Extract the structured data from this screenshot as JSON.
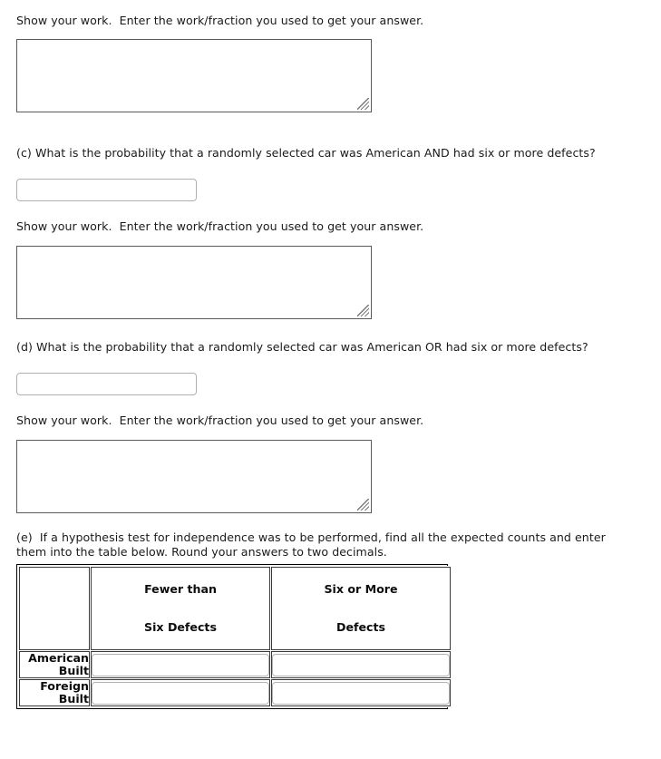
{
  "page": {
    "background": "#ffffff",
    "text_color": "#1a1a1a"
  },
  "sections": {
    "work_prompt_a": {
      "label": "Show your work.  Enter the work/fraction you used to get your answer.",
      "textarea_value": "",
      "textarea_placeholder": ""
    },
    "question_c": {
      "label": "(c) What is the probability that a randomly selected car was American AND had six or more defects?",
      "answer_value": "",
      "answer_placeholder": "",
      "work_label": "Show your work.  Enter the work/fraction you used to get your answer.",
      "work_value": ""
    },
    "question_d": {
      "label": "(d) What is the probability that a randomly selected car was American OR had six or more defects?",
      "answer_value": "",
      "answer_placeholder": "",
      "work_label": "Show your work.  Enter the work/fraction you used to get your answer.",
      "work_value": ""
    },
    "question_e": {
      "label_line1": "(e)  If a hypothesis test for independence was to be performed, find all the expected counts and enter",
      "label_line2": "them into the table below. Round your answers to two decimals."
    }
  },
  "expected_counts_table": {
    "corner_label": "",
    "column_headers": [
      {
        "line1": "Fewer than",
        "line2": "Six Defects"
      },
      {
        "line1": "Six or More",
        "line2": "Defects"
      }
    ],
    "rows": [
      {
        "label_line1": "American",
        "label_line2": "Built",
        "cells": [
          {
            "value": "",
            "placeholder": ""
          },
          {
            "value": "",
            "placeholder": ""
          }
        ]
      },
      {
        "label_line1": "Foreign",
        "label_line2": "Built",
        "cells": [
          {
            "value": "",
            "placeholder": ""
          },
          {
            "value": "",
            "placeholder": ""
          }
        ]
      }
    ]
  },
  "icons": {
    "resize_handle": "resize-grip-icon"
  }
}
